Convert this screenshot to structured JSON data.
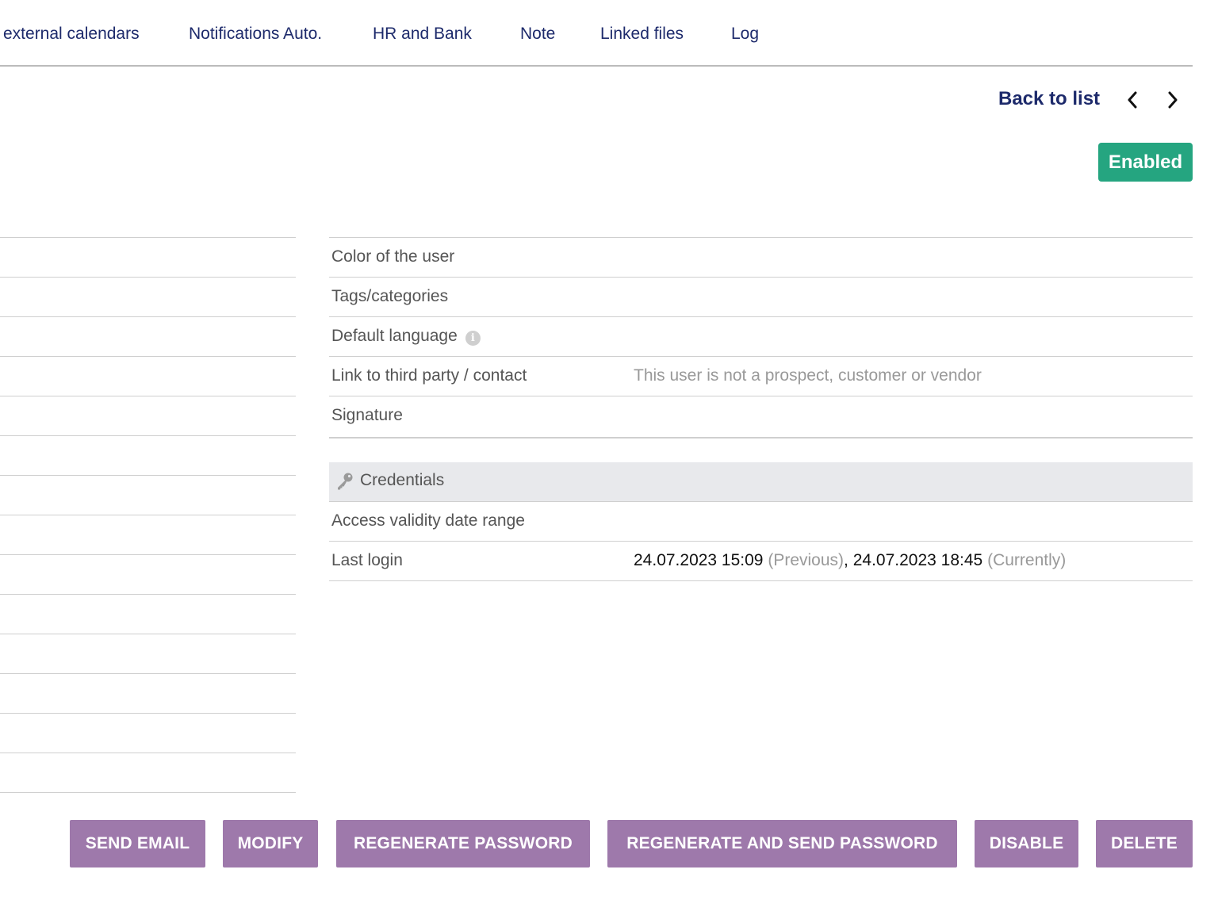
{
  "tabs": [
    {
      "label": "external calendars"
    },
    {
      "label": "Notifications Auto."
    },
    {
      "label": "HR and Bank"
    },
    {
      "label": "Note"
    },
    {
      "label": "Linked files"
    },
    {
      "label": "Log"
    }
  ],
  "nav": {
    "back_label": "Back to list",
    "prev_icon": "chevron-left-icon",
    "next_icon": "chevron-right-icon"
  },
  "status": {
    "label": "Enabled",
    "color": "#25a580"
  },
  "fields": [
    {
      "label": "Color of the user",
      "value": ""
    },
    {
      "label": "Tags/categories",
      "value": ""
    },
    {
      "label": "Default language",
      "value": "",
      "info_icon": "info-icon"
    },
    {
      "label": "Link to third party / contact",
      "value": "This user is not a prospect, customer or vendor"
    },
    {
      "label": "Signature",
      "value": ""
    }
  ],
  "credentials": {
    "title": "Credentials",
    "icon": "key-icon",
    "rows": [
      {
        "label": "Access validity date range"
      },
      {
        "label": "Last login"
      }
    ],
    "last_login": {
      "previous_date": "24.07.2023 15:09",
      "previous_note": "(Previous)",
      "separator": ",",
      "current_date": "24.07.2023 18:45",
      "current_note": "(Currently)"
    }
  },
  "actions": [
    {
      "label": "SEND EMAIL"
    },
    {
      "label": "MODIFY"
    },
    {
      "label": "REGENERATE PASSWORD"
    },
    {
      "label": "REGENERATE AND SEND PASSWORD"
    },
    {
      "label": "DISABLE"
    },
    {
      "label": "DELETE"
    }
  ],
  "colors": {
    "accent": "#9e79ab",
    "link": "#1d2a6b",
    "success": "#25a580"
  }
}
